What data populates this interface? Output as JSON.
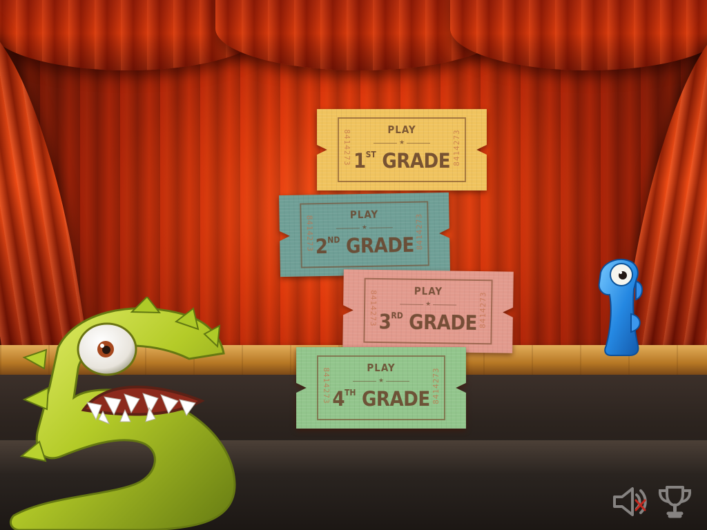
{
  "tickets": [
    {
      "play": "PLAY",
      "grade_number": "1",
      "grade_ordinal": "ST",
      "grade_word": "GRADE",
      "code_left": "8414273",
      "code_right": "8414273",
      "color": "#f0c35e"
    },
    {
      "play": "PLAY",
      "grade_number": "2",
      "grade_ordinal": "ND",
      "grade_word": "GRADE",
      "code_left": "8414273",
      "code_right": "8414273",
      "color": "#6f9f96"
    },
    {
      "play": "PLAY",
      "grade_number": "3",
      "grade_ordinal": "RD",
      "grade_word": "GRADE",
      "code_left": "8414273",
      "code_right": "8414273",
      "color": "#e29a8d"
    },
    {
      "play": "PLAY",
      "grade_number": "4",
      "grade_ordinal": "TH",
      "grade_word": "GRADE",
      "code_left": "8414273",
      "code_right": "8414273",
      "color": "#92c58c"
    }
  ],
  "controls": {
    "speaker_icon": "speaker-muted-icon",
    "trophy_icon": "trophy-icon"
  },
  "characters": {
    "left": "number-five-monster",
    "right": "number-one-fish"
  },
  "colors": {
    "curtain": "#d83d0d",
    "stage": "#c9872f",
    "stage_front": "#2c241f",
    "icon": "#85817f"
  }
}
